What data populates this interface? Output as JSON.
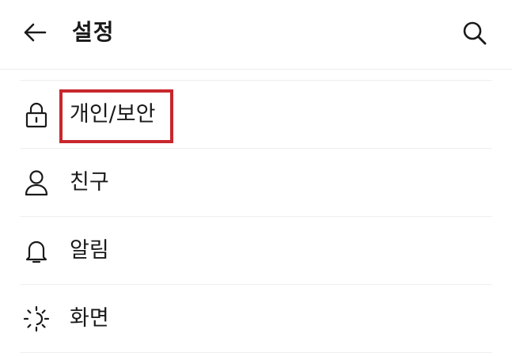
{
  "header": {
    "title": "설정",
    "back_icon": "arrow-left-icon",
    "search_icon": "search-icon"
  },
  "menu": {
    "items": [
      {
        "id": "privacy-security",
        "label": "개인/보안",
        "icon": "lock-icon"
      },
      {
        "id": "friends",
        "label": "친구",
        "icon": "person-icon"
      },
      {
        "id": "notifications",
        "label": "알림",
        "icon": "bell-icon"
      },
      {
        "id": "display",
        "label": "화면",
        "icon": "sun-icon"
      }
    ]
  },
  "annotation": {
    "highlight_color": "#c8272d",
    "highlighted_item": "privacy-security"
  }
}
